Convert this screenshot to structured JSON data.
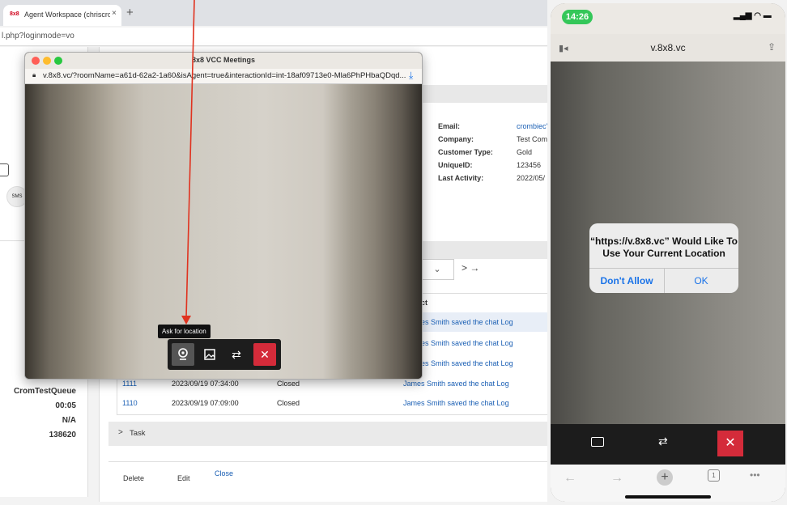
{
  "browser": {
    "tab_logo": "8x8",
    "tab_title": "Agent Workspace (chriscromi",
    "tab_close": "×",
    "new_tab": "+",
    "url": "l.php?loginmode=vo"
  },
  "left_panel": {
    "sms_label": "SMS",
    "queue_name": "CromTestQueue",
    "duration": "00:05",
    "na": "N/A",
    "number": "138620"
  },
  "customer": {
    "fields": [
      {
        "label": "Email:",
        "value": "crombiec'"
      },
      {
        "label": "Company:",
        "value": "Test Com"
      },
      {
        "label": "Customer Type:",
        "value": "Gold"
      },
      {
        "label": "UniqueID:",
        "value": "123456"
      },
      {
        "label": "Last Activity:",
        "value": "2022/05/"
      }
    ]
  },
  "history": {
    "column_partial": "ct",
    "rows": [
      {
        "id": "",
        "date": "",
        "status": "",
        "subject": "es Smith saved the chat Log"
      },
      {
        "id": "",
        "date": "",
        "status": "",
        "subject": "es Smith saved the chat Log"
      },
      {
        "id": "",
        "date": "",
        "status": "",
        "subject": "es Smith saved the chat Log"
      },
      {
        "id": "1111",
        "date": "2023/09/19 07:34:00",
        "status": "Closed",
        "subject": "James Smith saved the chat Log"
      },
      {
        "id": "1110",
        "date": "2023/09/19 07:09:00",
        "status": "Closed",
        "subject": "James Smith saved the chat Log"
      }
    ],
    "nav_arrows": "> →",
    "task_label": "Task",
    "actions": {
      "delete": "Delete",
      "edit": "Edit",
      "close": "Close"
    }
  },
  "meeting": {
    "window_title": "8x8 VCC Meetings",
    "url": "v.8x8.vc/?roomName=a61d-62a2-1a60&isAgent=true&interactionId=int-18af09713e0-Mla6PhPHbaQDqd...",
    "tooltip": "Ask for location",
    "controls": [
      "location-pin-icon",
      "image-icon",
      "switch-camera-icon",
      "hangup-icon"
    ],
    "hangup_color": "#d42b3a"
  },
  "phone": {
    "time": "14:26",
    "url": "v.8x8.vc",
    "alert_message": "“https://v.8x8.vc” Would Like To Use Your Current Location",
    "dont_allow": "Don't Allow",
    "ok": "OK",
    "tab_count": "1"
  },
  "annotation_color": "#e0321f"
}
